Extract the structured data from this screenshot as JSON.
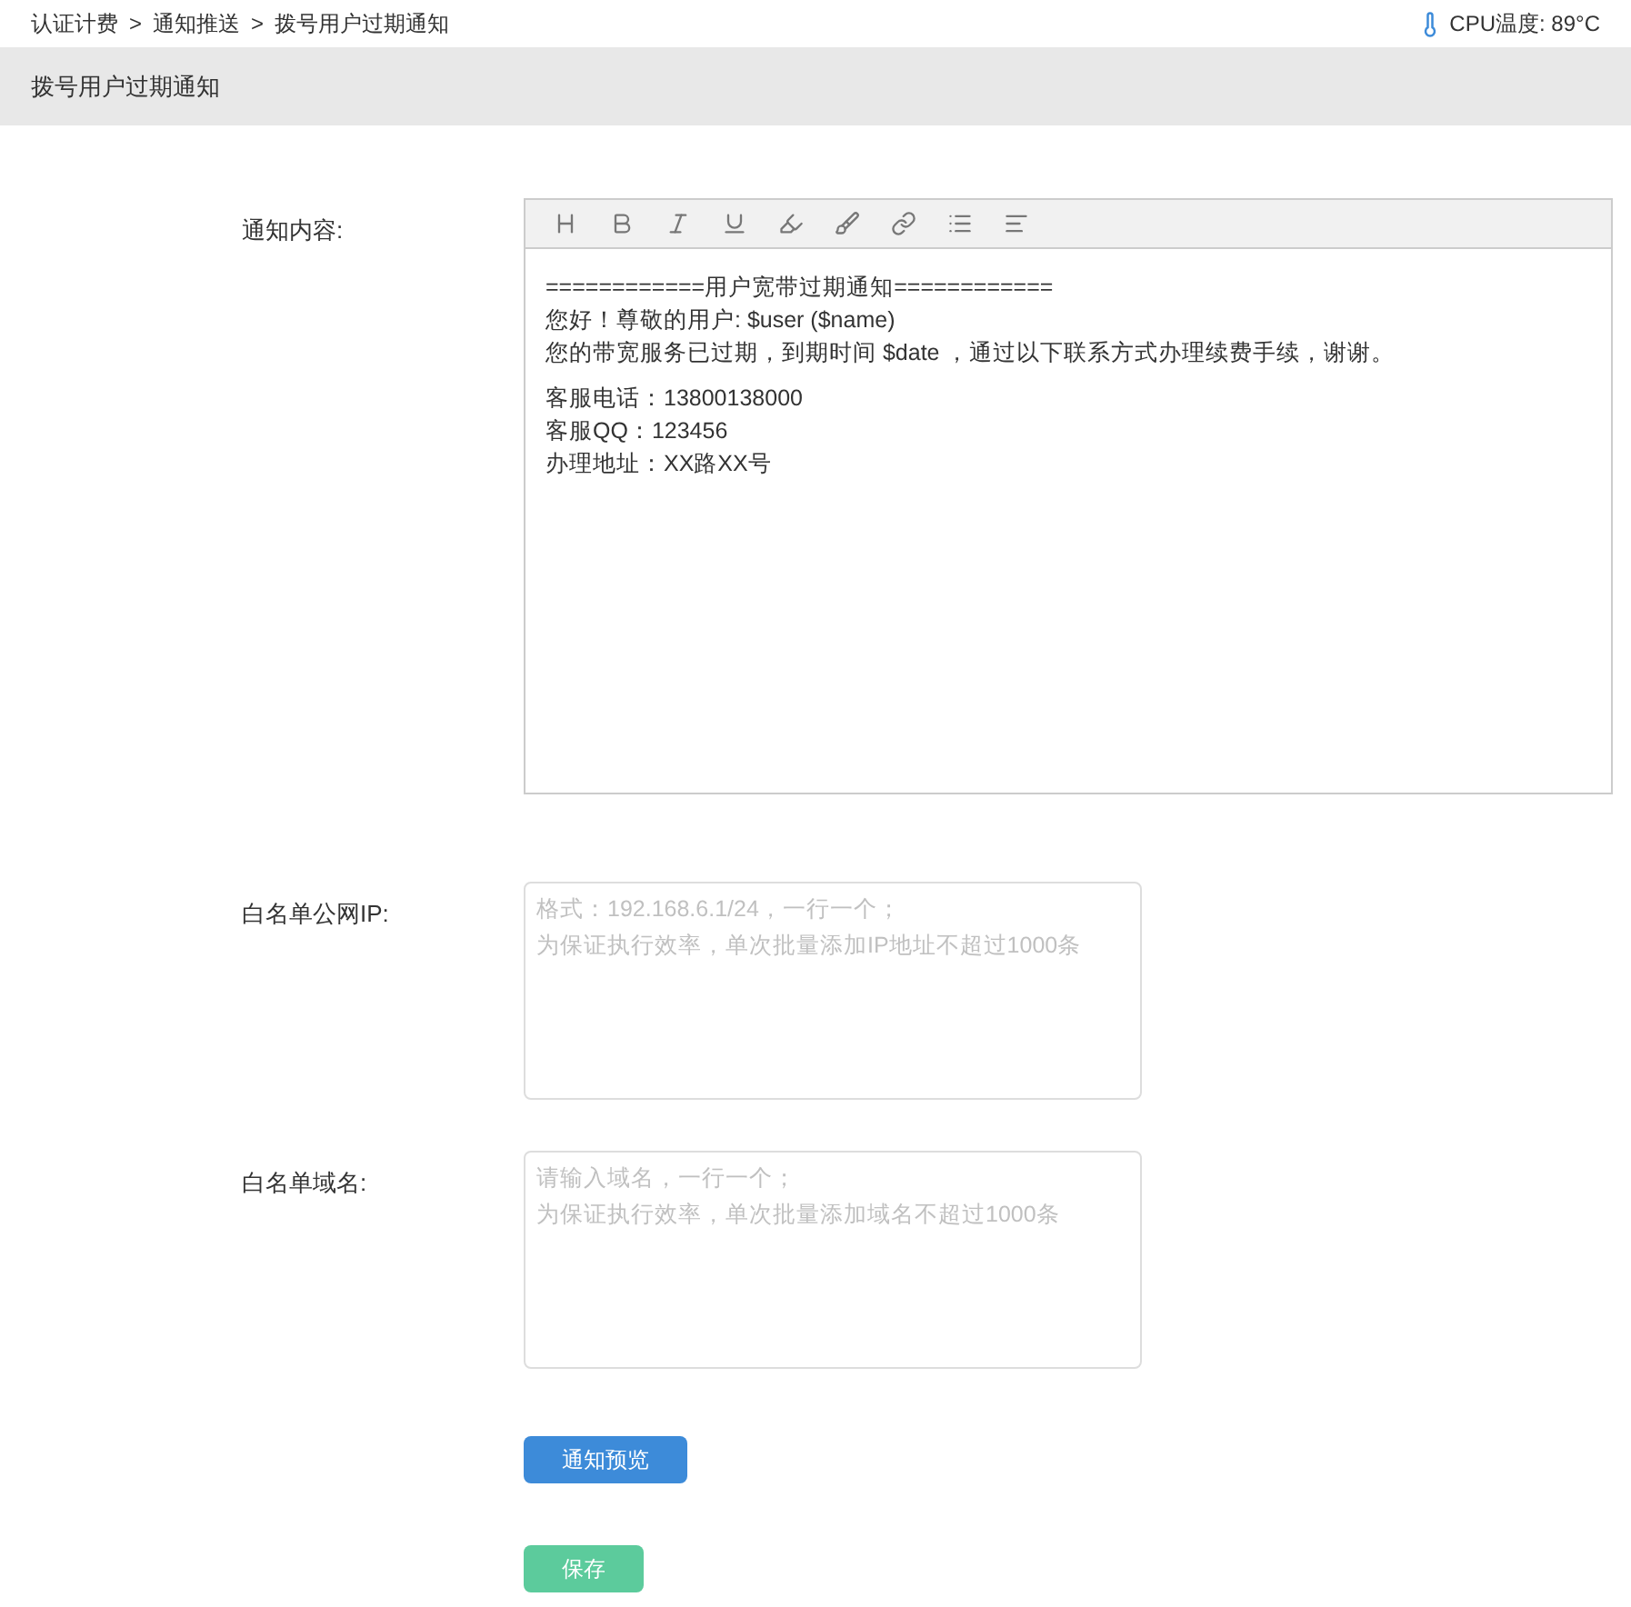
{
  "breadcrumb": [
    "认证计费",
    "通知推送",
    "拨号用户过期通知"
  ],
  "breadcrumb_separator": ">",
  "cpu_temperature": "CPU温度: 89°C",
  "page_title": "拨号用户过期通知",
  "editor": {
    "label": "通知内容:",
    "paragraphs": [
      [
        "============用户宽带过期通知============",
        "您好！尊敬的用户: $user ($name)",
        "您的带宽服务已过期，到期时间 $date ，通过以下联系方式办理续费手续，谢谢。"
      ],
      [
        "客服电话：13800138000",
        "客服QQ：123456",
        "办理地址：XX路XX号"
      ]
    ]
  },
  "whitelist_ip": {
    "label": "白名单公网IP:",
    "placeholder": [
      "格式：192.168.6.1/24，一行一个；",
      "为保证执行效率，单次批量添加IP地址不超过1000条"
    ]
  },
  "whitelist_domain": {
    "label": "白名单域名:",
    "placeholder": [
      "请输入域名，一行一个；",
      "为保证执行效率，单次批量添加域名不超过1000条"
    ]
  },
  "buttons": [
    {
      "label": "通知预览",
      "kind": "preview"
    },
    {
      "label": "保存",
      "kind": "save"
    }
  ]
}
